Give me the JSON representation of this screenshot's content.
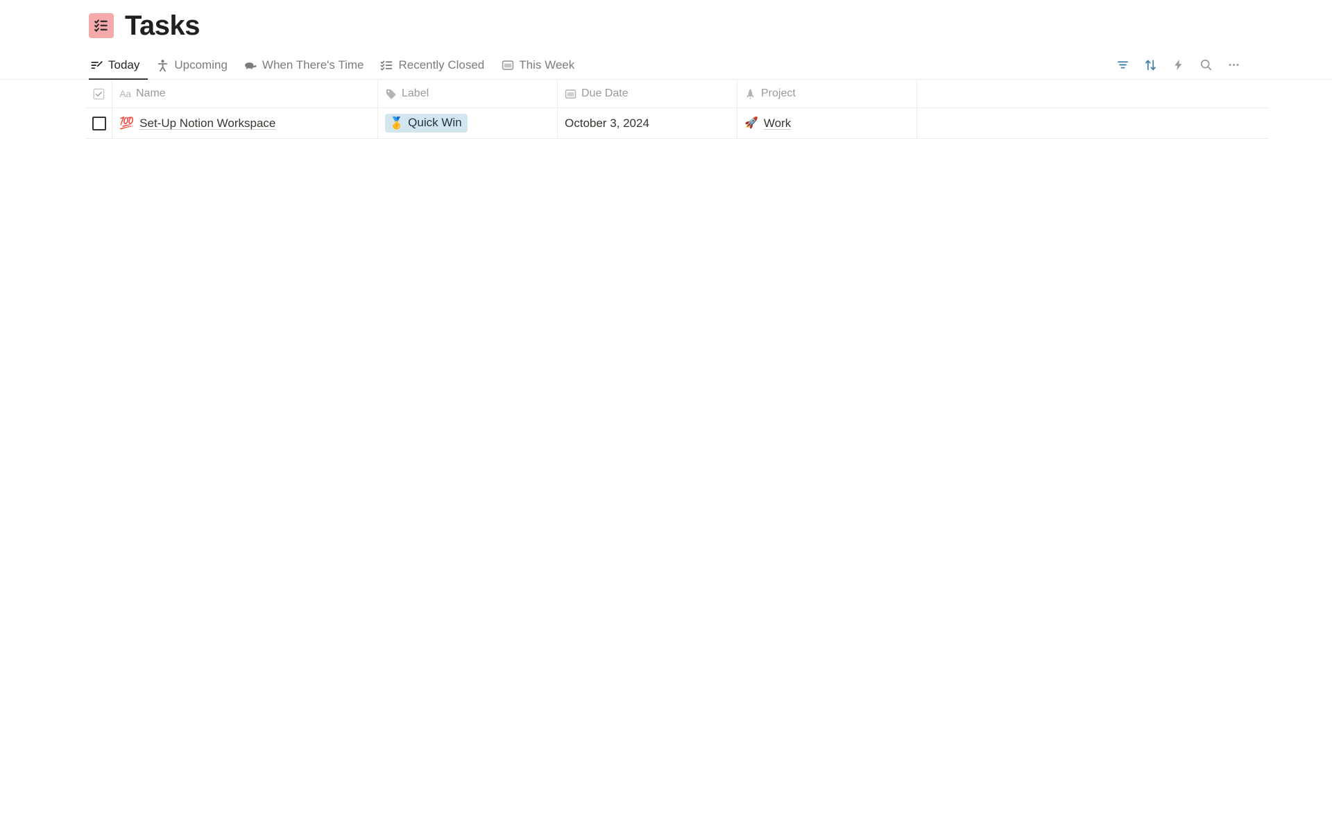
{
  "header": {
    "title": "Tasks",
    "icon": "checklist-icon",
    "icon_bg": "#f4aaaa"
  },
  "tabs": [
    {
      "label": "Today",
      "icon": "today-edit-list-icon",
      "active": true
    },
    {
      "label": "Upcoming",
      "icon": "running-person-icon",
      "active": false
    },
    {
      "label": "When There's Time",
      "icon": "turtle-icon",
      "active": false
    },
    {
      "label": "Recently Closed",
      "icon": "checklist-icon",
      "active": false
    },
    {
      "label": "This Week",
      "icon": "calendar-icon",
      "active": false
    }
  ],
  "toolbar": {
    "filter": {
      "name": "filter-icon",
      "title": "Filter",
      "color": "#3b7ea8",
      "active": true
    },
    "sort": {
      "name": "sort-icon",
      "title": "Sort",
      "color": "#3b7ea8",
      "active": true
    },
    "automation": {
      "name": "lightning-icon",
      "title": "Automations",
      "color": "#9b9a97",
      "active": false
    },
    "search": {
      "name": "search-icon",
      "title": "Search",
      "color": "#9b9a97",
      "active": false
    },
    "more": {
      "name": "more-icon",
      "title": "More",
      "color": "#9b9a97",
      "active": false
    }
  },
  "table": {
    "columns": [
      {
        "key": "check",
        "label": "",
        "icon": "checkbox-icon"
      },
      {
        "key": "name",
        "label": "Name",
        "icon": "title-aa-icon"
      },
      {
        "key": "label",
        "label": "Label",
        "icon": "tag-icon"
      },
      {
        "key": "due",
        "label": "Due Date",
        "icon": "calendar-icon"
      },
      {
        "key": "project",
        "label": "Project",
        "icon": "rocket-icon"
      }
    ],
    "rows": [
      {
        "checked": false,
        "name": "Set-Up Notion Workspace",
        "name_emoji": "💯",
        "label": "Quick Win",
        "label_emoji": "🥇",
        "label_bg": "#d3e5ef",
        "label_color": "#183347",
        "due": "October 3, 2024",
        "project": "Work",
        "project_emoji": "🚀"
      }
    ]
  }
}
